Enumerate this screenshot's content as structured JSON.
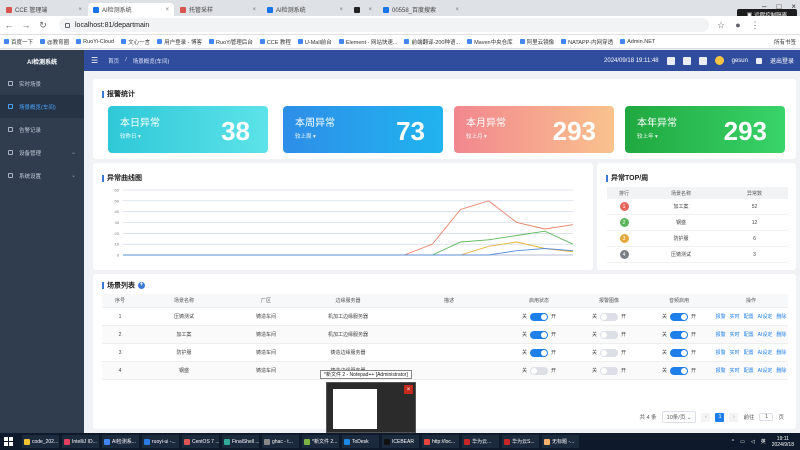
{
  "browser": {
    "tabs": [
      {
        "label": "CCE 管理端"
      },
      {
        "label": "AI检测系统"
      },
      {
        "label": "托管采样"
      },
      {
        "label": "AI检测系统"
      },
      {
        "label": ""
      },
      {
        "label": "00558_百度搜索"
      }
    ],
    "url": "localhost:81/departmain",
    "remote_badge": "远程控制隔离",
    "bookmarks": [
      "百度一下",
      "@教育圈",
      "RuoYi-Cloud",
      "文心一言",
      "用户登录 - 博客",
      "RuoYi管理后台",
      "CCE 教程",
      "U-Mall前台",
      "Element - 网站快速...",
      "前端翻译-200种语...",
      "Maven中央仓库",
      "阿里云镜像",
      "NATAPP-内网穿透",
      "Admin.NET"
    ],
    "bookmarks_right": "所有书签"
  },
  "sidebar": {
    "title": "AI检测系统",
    "items": [
      {
        "label": "实时场景"
      },
      {
        "label": "场景概览(车间)"
      },
      {
        "label": "告警记录"
      },
      {
        "label": "设备管理"
      },
      {
        "label": "系统设置"
      }
    ]
  },
  "header": {
    "crumb_home": "首页",
    "crumb_current": "场景概览(车间)",
    "datetime": "2024/09/18 19:11:48",
    "username": "gesun",
    "logout": "退出登录"
  },
  "stats": {
    "title": "报警统计",
    "cards": [
      {
        "label": "本日异常",
        "sub": "较昨日",
        "value": "38",
        "color_from": "#2fc8d8",
        "color_to": "#5de3e9"
      },
      {
        "label": "本周异常",
        "sub": "较上周",
        "value": "73",
        "color_from": "#2e8ee8",
        "color_to": "#20b4ef"
      },
      {
        "label": "本月异常",
        "sub": "较上月",
        "value": "293",
        "color_from": "#f2878f",
        "color_to": "#f9c28d"
      },
      {
        "label": "本年异常",
        "sub": "较上年",
        "value": "293",
        "color_from": "#20a83f",
        "color_to": "#38d46a"
      }
    ]
  },
  "chart_panel": {
    "title": "异常曲线图"
  },
  "chart_data": {
    "type": "line",
    "title": "异常曲线图",
    "ylim": [
      0,
      60
    ],
    "yticks": [
      "60",
      "50",
      "40",
      "30",
      "20",
      "10",
      "0"
    ],
    "x": [
      "",
      "",
      "",
      "",
      "",
      "",
      "",
      "",
      "",
      "",
      "",
      "",
      "",
      "",
      "",
      "",
      ""
    ],
    "series": [
      {
        "color": "#e8836b",
        "values": [
          0,
          0,
          0,
          0,
          0,
          0,
          0,
          0,
          0,
          0,
          0,
          10,
          42,
          50,
          30,
          24,
          28
        ]
      },
      {
        "color": "#5cb85c",
        "values": [
          0,
          0,
          0,
          0,
          0,
          0,
          0,
          0,
          0,
          0,
          0,
          0,
          12,
          14,
          18,
          22,
          10
        ]
      },
      {
        "color": "#e4b23c",
        "values": [
          0,
          0,
          0,
          0,
          0,
          0,
          0,
          0,
          0,
          0,
          0,
          0,
          0,
          8,
          12,
          6,
          3
        ]
      },
      {
        "color": "#5b8fd9",
        "values": [
          0,
          0,
          0,
          0,
          0,
          0,
          0,
          0,
          0,
          0,
          0,
          0,
          0,
          0,
          4,
          6,
          4
        ]
      }
    ],
    "grid": true
  },
  "top": {
    "title": "异常TOP/周",
    "headers": [
      "排行",
      "场景名称",
      "异常数"
    ],
    "rows": [
      {
        "rank": "1",
        "name": "加工案",
        "count": "52",
        "color": "#e5655a"
      },
      {
        "rank": "2",
        "name": "钢盛",
        "count": "12",
        "color": "#5ab55d"
      },
      {
        "rank": "3",
        "name": "防护服",
        "count": "6",
        "color": "#e4a73a"
      },
      {
        "rank": "4",
        "name": "压铸测试",
        "count": "3",
        "color": "#7a7f87"
      }
    ]
  },
  "list": {
    "title": "场景列表",
    "headers": [
      "序号",
      "场景名称",
      "厂区",
      "边缘服务器",
      "描述",
      "启用状态",
      "报警图像",
      "音频启用",
      "操作"
    ],
    "switch_off": "关",
    "switch_on": "开",
    "ops": [
      "报警",
      "实时",
      "配置",
      "AI设定",
      "删除"
    ],
    "rows": [
      {
        "no": "1",
        "name": "压铸测试",
        "area": "铸造车间",
        "server": "机加工边缘服务器",
        "desc": "",
        "enabled": true,
        "alarm": false,
        "audio": true
      },
      {
        "no": "2",
        "name": "加工案",
        "area": "铸造车间",
        "server": "机加工边缘服务器",
        "desc": "",
        "enabled": true,
        "alarm": false,
        "audio": true
      },
      {
        "no": "3",
        "name": "防护服",
        "area": "铸造车间",
        "server": "铸造边缘服务器",
        "desc": "",
        "enabled": true,
        "alarm": false,
        "audio": true
      },
      {
        "no": "4",
        "name": "钢盛",
        "area": "铸造车间",
        "server": "铸造边缘服务器",
        "desc": "",
        "enabled": false,
        "alarm": false,
        "audio": true
      }
    ],
    "pager": {
      "total": "共 4 条",
      "per_page": "10条/页",
      "page": "1",
      "goto": "前往",
      "goto_value": "1",
      "page_suffix": "页"
    }
  },
  "overlay": {
    "tooltip": "*新文件 2 - Notepad++ [Administrator]",
    "close": "×"
  },
  "taskbar": {
    "items": [
      {
        "label": "code_202...",
        "color": "#f1c232"
      },
      {
        "label": "IntelliJ ID...",
        "color": "#e0415f"
      },
      {
        "label": "AI检测系...",
        "color": "#4285f4"
      },
      {
        "label": "ruoyi-ui -...",
        "color": "#2b7be4"
      },
      {
        "label": "CentOS 7 ...",
        "color": "#d55"
      },
      {
        "label": "FinalShell ...",
        "color": "#3a9"
      },
      {
        "label": "ghac - t...",
        "color": "#888"
      },
      {
        "label": "*新文件 2...",
        "color": "#7cb342"
      },
      {
        "label": "ToDesk",
        "color": "#1e88e5"
      },
      {
        "label": "ICEBEAR",
        "color": "#111"
      },
      {
        "label": "http://loc...",
        "color": "#e8453c"
      },
      {
        "label": "华为云...",
        "color": "#c62828"
      },
      {
        "label": "华为云S...",
        "color": "#c62828"
      },
      {
        "label": "无标题 -...",
        "color": "#f6b26b"
      }
    ],
    "time": "19:11",
    "date": "2024/9/18",
    "ime": "英"
  }
}
